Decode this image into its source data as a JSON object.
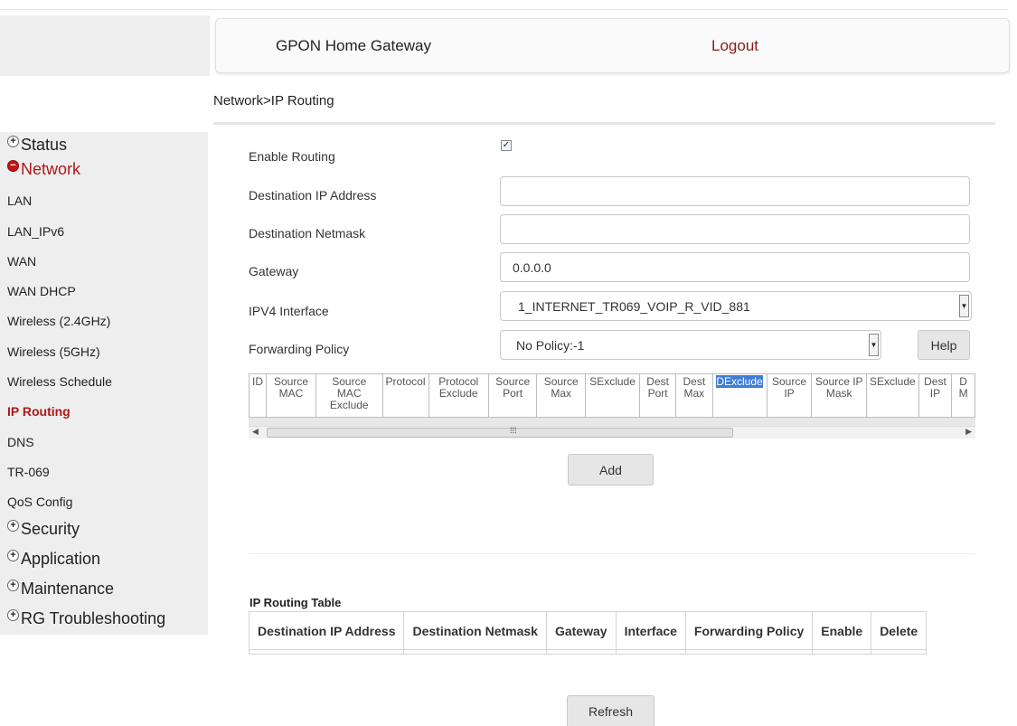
{
  "header": {
    "title": "GPON Home Gateway",
    "logout": "Logout"
  },
  "breadcrumb": "Network>IP Routing",
  "sidebar": {
    "status": "Status",
    "network": "Network",
    "items": [
      "LAN",
      "LAN_IPv6",
      "WAN",
      "WAN DHCP",
      "Wireless (2.4GHz)",
      "Wireless (5GHz)",
      "Wireless Schedule",
      "IP Routing",
      "DNS",
      "TR-069",
      "QoS Config"
    ],
    "security": "Security",
    "application": "Application",
    "maintenance": "Maintenance",
    "rg_troubleshooting": "RG Troubleshooting"
  },
  "form": {
    "enable_routing_label": "Enable Routing",
    "enable_routing_checked": true,
    "dest_ip_label": "Destination IP Address",
    "dest_ip_value": "",
    "dest_netmask_label": "Destination Netmask",
    "dest_netmask_value": "",
    "gateway_label": "Gateway",
    "gateway_value": "0.0.0.0",
    "ipv4_if_label": "IPV4 Interface",
    "ipv4_if_value": "1_INTERNET_TR069_VOIP_R_VID_881",
    "fwd_policy_label": "Forwarding Policy",
    "fwd_policy_value": "No Policy:-1",
    "help": "Help"
  },
  "policy_columns": [
    "ID",
    "Source MAC",
    "Source MAC Exclude",
    "Protocol",
    "Protocol Exclude",
    "Source Port",
    "Source Max",
    "SExclude",
    "Dest Port",
    "Dest Max",
    "DExclude",
    "Source IP",
    "Source IP Mask",
    "SExclude",
    "Dest IP",
    "D M"
  ],
  "add_button": "Add",
  "routing_table": {
    "title": "IP Routing Table",
    "columns": [
      "Destination IP Address",
      "Destination Netmask",
      "Gateway",
      "Interface",
      "Forwarding Policy",
      "Enable",
      "Delete"
    ]
  },
  "refresh_button": "Refresh"
}
